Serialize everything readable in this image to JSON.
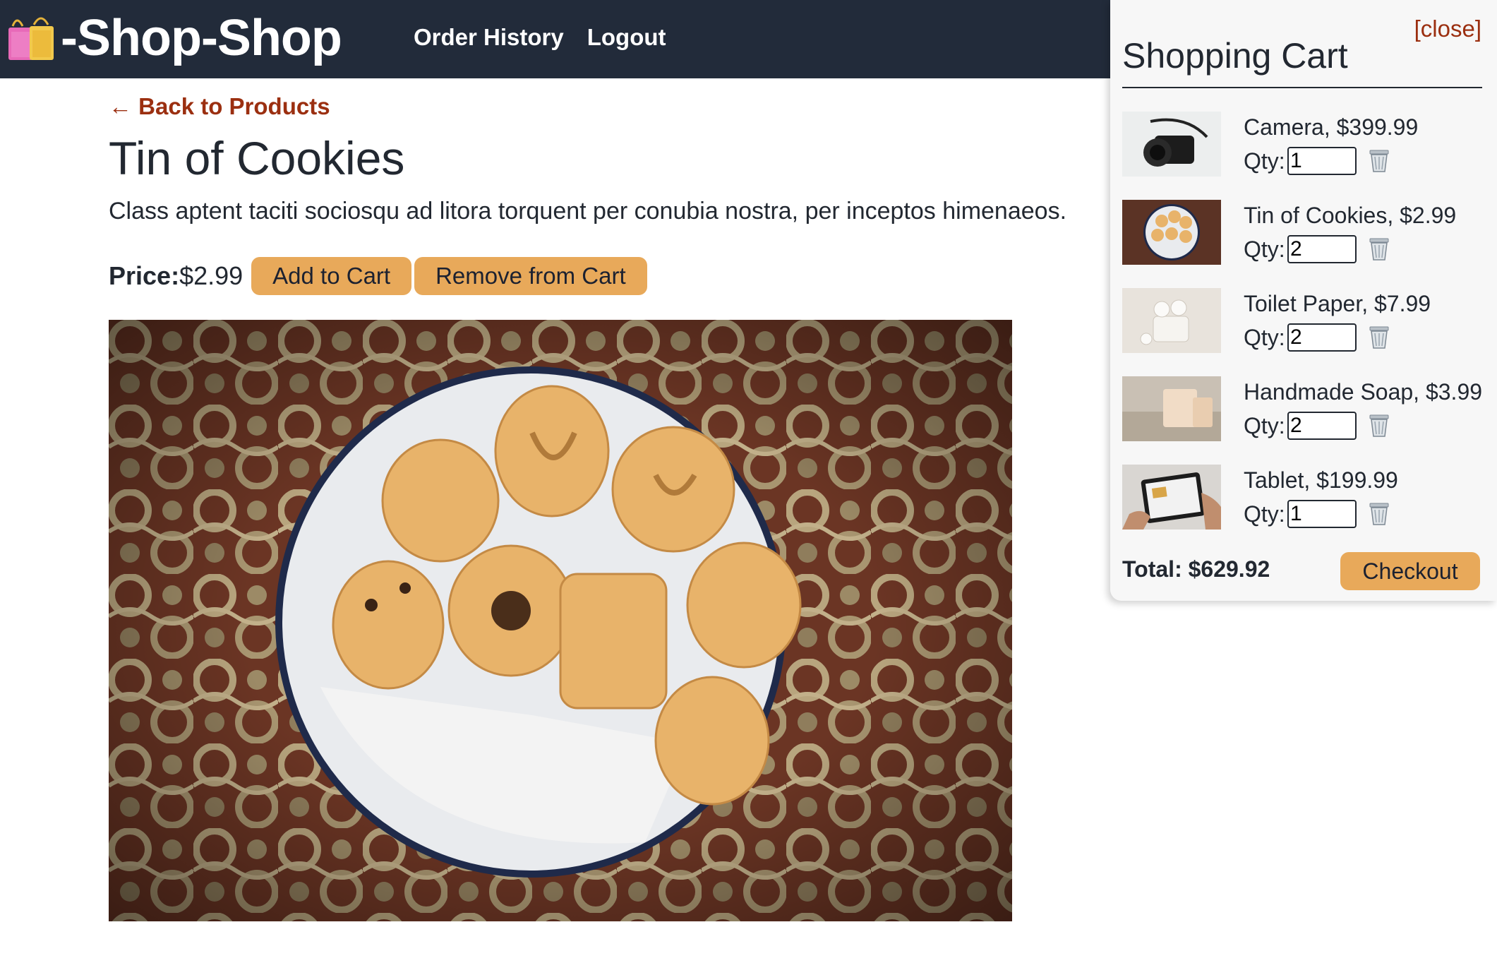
{
  "brand": {
    "name": "-Shop-Shop",
    "icon": "shopping-bags-icon"
  },
  "nav": {
    "order_history": "Order History",
    "logout": "Logout"
  },
  "product": {
    "back_link": "← Back to Products",
    "title": "Tin of Cookies",
    "description": "Class aptent taciti sociosqu ad litora torquent per conubia nostra, per inceptos himenaeos.",
    "price_label": "Price:",
    "price_value": "$2.99",
    "add_button": "Add to Cart",
    "remove_button": "Remove from Cart",
    "image": "tin-of-cookies-photo"
  },
  "cart": {
    "close_label": "[close]",
    "title": "Shopping Cart",
    "qty_label": "Qty:",
    "items": [
      {
        "label": "Camera, $399.99",
        "qty": "1",
        "thumb": "camera-photo"
      },
      {
        "label": "Tin of Cookies, $2.99",
        "qty": "2",
        "thumb": "cookies-photo"
      },
      {
        "label": "Toilet Paper, $7.99",
        "qty": "2",
        "thumb": "toilet-paper-photo"
      },
      {
        "label": "Handmade Soap, $3.99",
        "qty": "2",
        "thumb": "soap-photo"
      },
      {
        "label": "Tablet, $199.99",
        "qty": "1",
        "thumb": "tablet-photo"
      }
    ],
    "total": "Total: $629.92",
    "checkout": "Checkout"
  },
  "colors": {
    "header_bg": "#222b3a",
    "accent_button": "#e8a95a",
    "link": "#9b2f10",
    "text": "#222831"
  }
}
